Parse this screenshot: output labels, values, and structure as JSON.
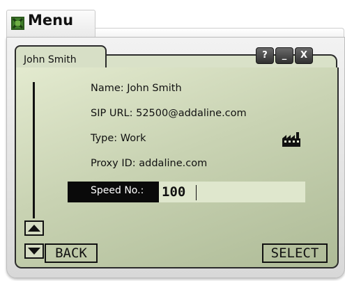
{
  "window": {
    "title": "Menu",
    "controls": {
      "help": "?",
      "minimize": "_",
      "close": "X"
    }
  },
  "contact": {
    "name": "John Smith",
    "details": [
      {
        "key": "name",
        "text": "Name: John Smith"
      },
      {
        "key": "sip",
        "text": "SIP URL: 52500@addaline.com"
      },
      {
        "key": "type",
        "text": "Type: Work"
      },
      {
        "key": "proxy",
        "text": "Proxy ID: addaline.com"
      }
    ],
    "type_icon": "factory-icon"
  },
  "speed_dial": {
    "label": "Speed No.:",
    "value": "100"
  },
  "softkeys": {
    "back": "BACK",
    "select": "SELECT"
  },
  "colors": {
    "screen": "#c9d3b3",
    "frame": "#e8e8e8",
    "ink": "#111111"
  }
}
